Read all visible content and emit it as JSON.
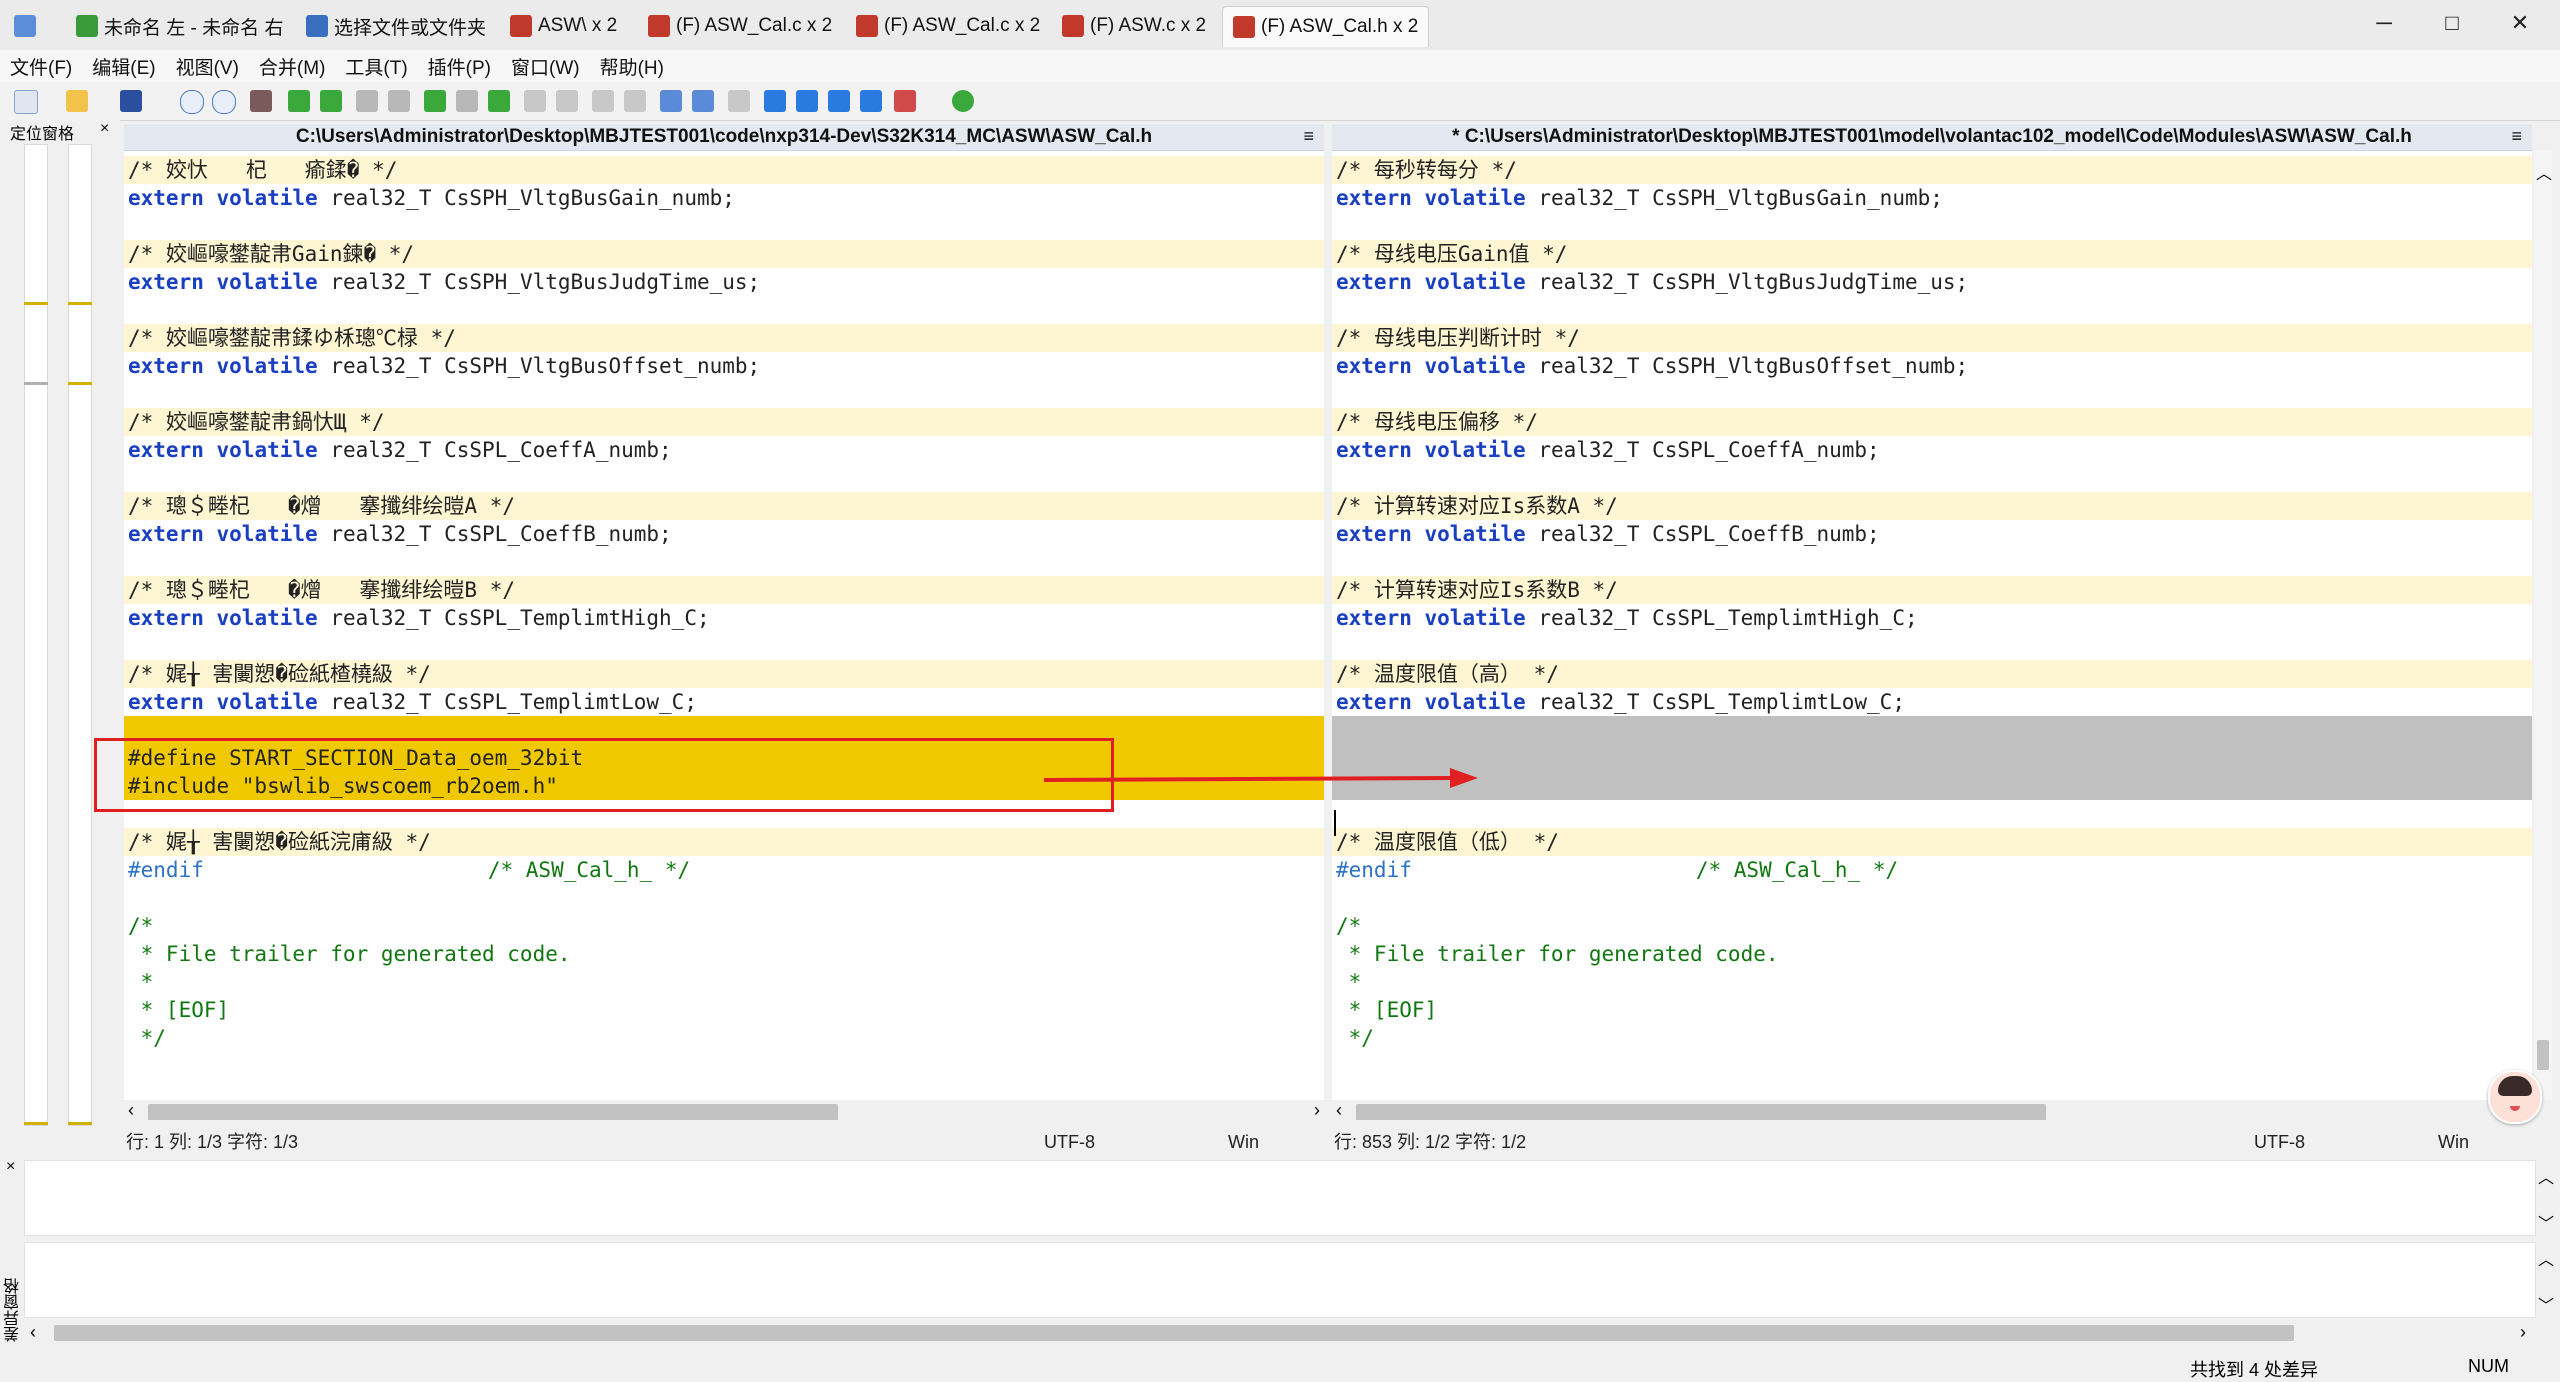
{
  "tabs": [
    {
      "label": "未命名 左 - 未命名 右",
      "color": "#3a9a3a"
    },
    {
      "label": "选择文件或文件夹",
      "color": "#3a6fc0"
    },
    {
      "label": "ASW\\ x 2",
      "color": "#c0392b"
    },
    {
      "label": "(F) ASW_Cal.c x 2",
      "color": "#c0392b"
    },
    {
      "label": "(F) ASW_Cal.c x 2",
      "color": "#c0392b"
    },
    {
      "label": "(F) ASW.c x 2",
      "color": "#c0392b"
    },
    {
      "label": "(F) ASW_Cal.h x 2",
      "color": "#c0392b"
    }
  ],
  "window": {
    "minimize": "─",
    "maximize": "□",
    "close": "✕"
  },
  "menu": [
    "文件(F)",
    "编辑(E)",
    "视图(V)",
    "合并(M)",
    "工具(T)",
    "插件(P)",
    "窗口(W)",
    "帮助(H)"
  ],
  "locator": {
    "title": "定位窗格",
    "close": "×"
  },
  "left": {
    "path": "C:\\Users\\Administrator\\Desktop\\MBJTEST001\\code\\nxp314-Dev\\S32K314_MC\\ASW\\ASW_Cal.h",
    "pane_menu": "≡",
    "status": {
      "pos": "行: 1  列: 1/3  字符: 1/3",
      "enc": "UTF-8",
      "eol": "Win"
    }
  },
  "right": {
    "path": "* C:\\Users\\Administrator\\Desktop\\MBJTEST001\\model\\volantac102_model\\Code\\Modules\\ASW\\ASW_Cal.h",
    "pane_menu": "≡",
    "status": {
      "pos": "行: 853  列: 1/2  字符: 1/2",
      "enc": "UTF-8",
      "eol": "Win"
    }
  },
  "code_left": [
    {
      "t": "cmt",
      "text": "/* 姣忕   杞   瘉鍒� */"
    },
    {
      "t": "decl",
      "kw1": "extern",
      "kw2": "volatile",
      "rest": " real32_T CsSPH_VltgBusGain_numb;"
    },
    {
      "t": "blank"
    },
    {
      "t": "cmt",
      "text": "/* 姣嶇嚎鐢靛帇Gain鍊� */"
    },
    {
      "t": "decl",
      "kw1": "extern",
      "kw2": "volatile",
      "rest": " real32_T CsSPH_VltgBusJudgTime_us;"
    },
    {
      "t": "blank"
    },
    {
      "t": "cmt",
      "text": "/* 姣嶇嚎鐢靛帇鍒ゆ柇璁℃椂 */"
    },
    {
      "t": "decl",
      "kw1": "extern",
      "kw2": "volatile",
      "rest": " real32_T CsSPH_VltgBusOffset_numb;"
    },
    {
      "t": "blank"
    },
    {
      "t": "cmt",
      "text": "/* 姣嶇嚎鐢靛帇鍋忕Щ */"
    },
    {
      "t": "decl",
      "kw1": "extern",
      "kw2": "volatile",
      "rest": " real32_T CsSPL_CoeffA_numb;"
    },
    {
      "t": "blank"
    },
    {
      "t": "cmt",
      "text": "/* 璁＄畻杞   �熷   搴攕绯绘暟A */"
    },
    {
      "t": "decl",
      "kw1": "extern",
      "kw2": "volatile",
      "rest": " real32_T CsSPL_CoeffB_numb;"
    },
    {
      "t": "blank"
    },
    {
      "t": "cmt",
      "text": "/* 璁＄畻杞   �熷   搴攕绯绘暟B */"
    },
    {
      "t": "decl",
      "kw1": "extern",
      "kw2": "volatile",
      "rest": " real32_T CsSPL_TemplimtHigh_C;"
    },
    {
      "t": "blank"
    },
    {
      "t": "cmt",
      "text": "/* 娓╁ 害闄愬�硷紙楂橈級 */"
    },
    {
      "t": "decl",
      "kw1": "extern",
      "kw2": "volatile",
      "rest": " real32_T CsSPL_TemplimtLow_C;"
    },
    {
      "t": "diff",
      "text": ""
    },
    {
      "t": "diff",
      "text": "#define START_SECTION_Data_oem_32bit"
    },
    {
      "t": "diff",
      "text": "#include \"bswlib_swscoem_rb2oem.h\""
    },
    {
      "t": "blank"
    },
    {
      "t": "cmt",
      "text": "/* 娓╁ 害闄愬�硷紙浣庯級 */"
    },
    {
      "t": "endif",
      "kw": "#endif",
      "cmt": "/* ASW_Cal_h_ */"
    },
    {
      "t": "blank"
    },
    {
      "t": "green",
      "text": "/*"
    },
    {
      "t": "green",
      "text": " * File trailer for generated code."
    },
    {
      "t": "green",
      "text": " *"
    },
    {
      "t": "green",
      "text": " * [EOF]"
    },
    {
      "t": "green",
      "text": " */"
    }
  ],
  "code_right": [
    {
      "t": "cmt",
      "text": "/* 每秒转每分 */"
    },
    {
      "t": "decl",
      "kw1": "extern",
      "kw2": "volatile",
      "rest": " real32_T CsSPH_VltgBusGain_numb;"
    },
    {
      "t": "blank"
    },
    {
      "t": "cmt",
      "text": "/* 母线电压Gain值 */"
    },
    {
      "t": "decl",
      "kw1": "extern",
      "kw2": "volatile",
      "rest": " real32_T CsSPH_VltgBusJudgTime_us;"
    },
    {
      "t": "blank"
    },
    {
      "t": "cmt",
      "text": "/* 母线电压判断计时 */"
    },
    {
      "t": "decl",
      "kw1": "extern",
      "kw2": "volatile",
      "rest": " real32_T CsSPH_VltgBusOffset_numb;"
    },
    {
      "t": "blank"
    },
    {
      "t": "cmt",
      "text": "/* 母线电压偏移 */"
    },
    {
      "t": "decl",
      "kw1": "extern",
      "kw2": "volatile",
      "rest": " real32_T CsSPL_CoeffA_numb;"
    },
    {
      "t": "blank"
    },
    {
      "t": "cmt",
      "text": "/* 计算转速对应Is系数A */"
    },
    {
      "t": "decl",
      "kw1": "extern",
      "kw2": "volatile",
      "rest": " real32_T CsSPL_CoeffB_numb;"
    },
    {
      "t": "blank"
    },
    {
      "t": "cmt",
      "text": "/* 计算转速对应Is系数B */"
    },
    {
      "t": "decl",
      "kw1": "extern",
      "kw2": "volatile",
      "rest": " real32_T CsSPL_TemplimtHigh_C;"
    },
    {
      "t": "blank"
    },
    {
      "t": "cmt",
      "text": "/* 温度限值（高） */"
    },
    {
      "t": "decl",
      "kw1": "extern",
      "kw2": "volatile",
      "rest": " real32_T CsSPL_TemplimtLow_C;"
    },
    {
      "t": "gray",
      "text": ""
    },
    {
      "t": "gray",
      "text": ""
    },
    {
      "t": "gray",
      "text": ""
    },
    {
      "t": "blank"
    },
    {
      "t": "cmt",
      "text": "/* 温度限值（低） */"
    },
    {
      "t": "endif",
      "kw": "#endif",
      "cmt": "/* ASW_Cal_h_ */"
    },
    {
      "t": "blank"
    },
    {
      "t": "green",
      "text": "/*"
    },
    {
      "t": "green",
      "text": " * File trailer for generated code."
    },
    {
      "t": "green",
      "text": " *"
    },
    {
      "t": "green",
      "text": " * [EOF]"
    },
    {
      "t": "green",
      "text": " */"
    }
  ],
  "bottom": {
    "pane_title": "差异窗格",
    "close": "×"
  },
  "statusbar": {
    "diff_count": "共找到 4 处差异",
    "num": "NUM"
  },
  "colors": {
    "diff_yellow": "#f0c800",
    "comment_bg": "#fef6d2",
    "gray_block": "#c0c0c0",
    "keyword": "#1a3fc0",
    "comment": "#117711",
    "annotation_red": "#e02020"
  }
}
